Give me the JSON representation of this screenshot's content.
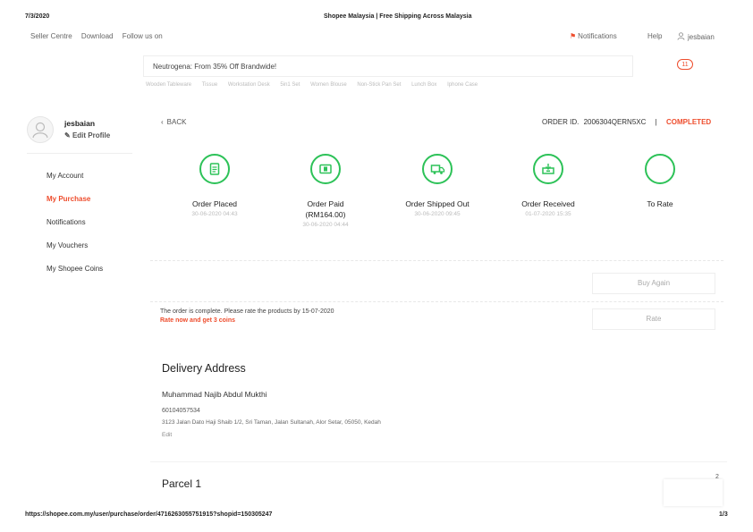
{
  "print_header": {
    "date": "7/3/2020",
    "page_title": "Shopee Malaysia | Free Shipping Across Malaysia"
  },
  "print_footer": {
    "url": "https://shopee.com.my/user/purchase/order/4716263055751915?shopid=150305247",
    "page": "1/3"
  },
  "topbar": {
    "links": [
      "Seller Centre",
      "Download",
      "Follow us on"
    ],
    "notifications": "Notifications",
    "help": "Help",
    "username": "jesbaian"
  },
  "search": {
    "value": "Neutrogena: From 35% Off Brandwide!"
  },
  "cart": {
    "count": "11"
  },
  "suggestions": [
    "Wooden Tableware",
    "Tissue",
    "Workstation Desk",
    "5in1 Set",
    "Women Blouse",
    "Non-Stick Pan Set",
    "Lunch Box",
    "Iphone Case"
  ],
  "sidebar": {
    "username": "jesbaian",
    "edit_profile": "Edit Profile",
    "items": [
      {
        "label": "My Account",
        "active": false
      },
      {
        "label": "My Purchase",
        "active": true
      },
      {
        "label": "Notifications",
        "active": false
      },
      {
        "label": "My Vouchers",
        "active": false
      },
      {
        "label": "My Shopee Coins",
        "active": false
      }
    ]
  },
  "order": {
    "back_label": "BACK",
    "order_id_label": "ORDER ID.",
    "order_id": "2006304QERN5XC",
    "separator": "|",
    "status": "COMPLETED",
    "steps": [
      {
        "label": "Order Placed",
        "time": "30-06-2020 04:43",
        "icon": "receipt-icon"
      },
      {
        "label": "Order Paid\n(RM164.00)",
        "time": "30-06-2020 04:44",
        "icon": "payment-icon"
      },
      {
        "label": "Order Shipped Out",
        "time": "30-06-2020 09:45",
        "icon": "truck-icon"
      },
      {
        "label": "Order Received",
        "time": "01-07-2020 15:35",
        "icon": "box-icon"
      },
      {
        "label": "To Rate",
        "time": "",
        "icon": "star-icon"
      }
    ],
    "buy_again": "Buy Again",
    "complete_msg": "The order is complete. Please rate the products by 15-07-2020",
    "rate_msg": "Rate now and get 3 coins",
    "rate_button": "Rate"
  },
  "delivery": {
    "title": "Delivery Address",
    "name": "Muhammad Najib Abdul Mukthi",
    "phone": "60104057534",
    "address": "3123 Jalan Dato Haji Shaib 1/2, Sri Taman, Jalan Sultanah, Alor Setar, 05050, Kedah",
    "edit": "Edit"
  },
  "parcel": {
    "title": "Parcel 1",
    "count": "2"
  },
  "colors": {
    "accent": "#ee4d2d",
    "success": "#2dc258"
  }
}
